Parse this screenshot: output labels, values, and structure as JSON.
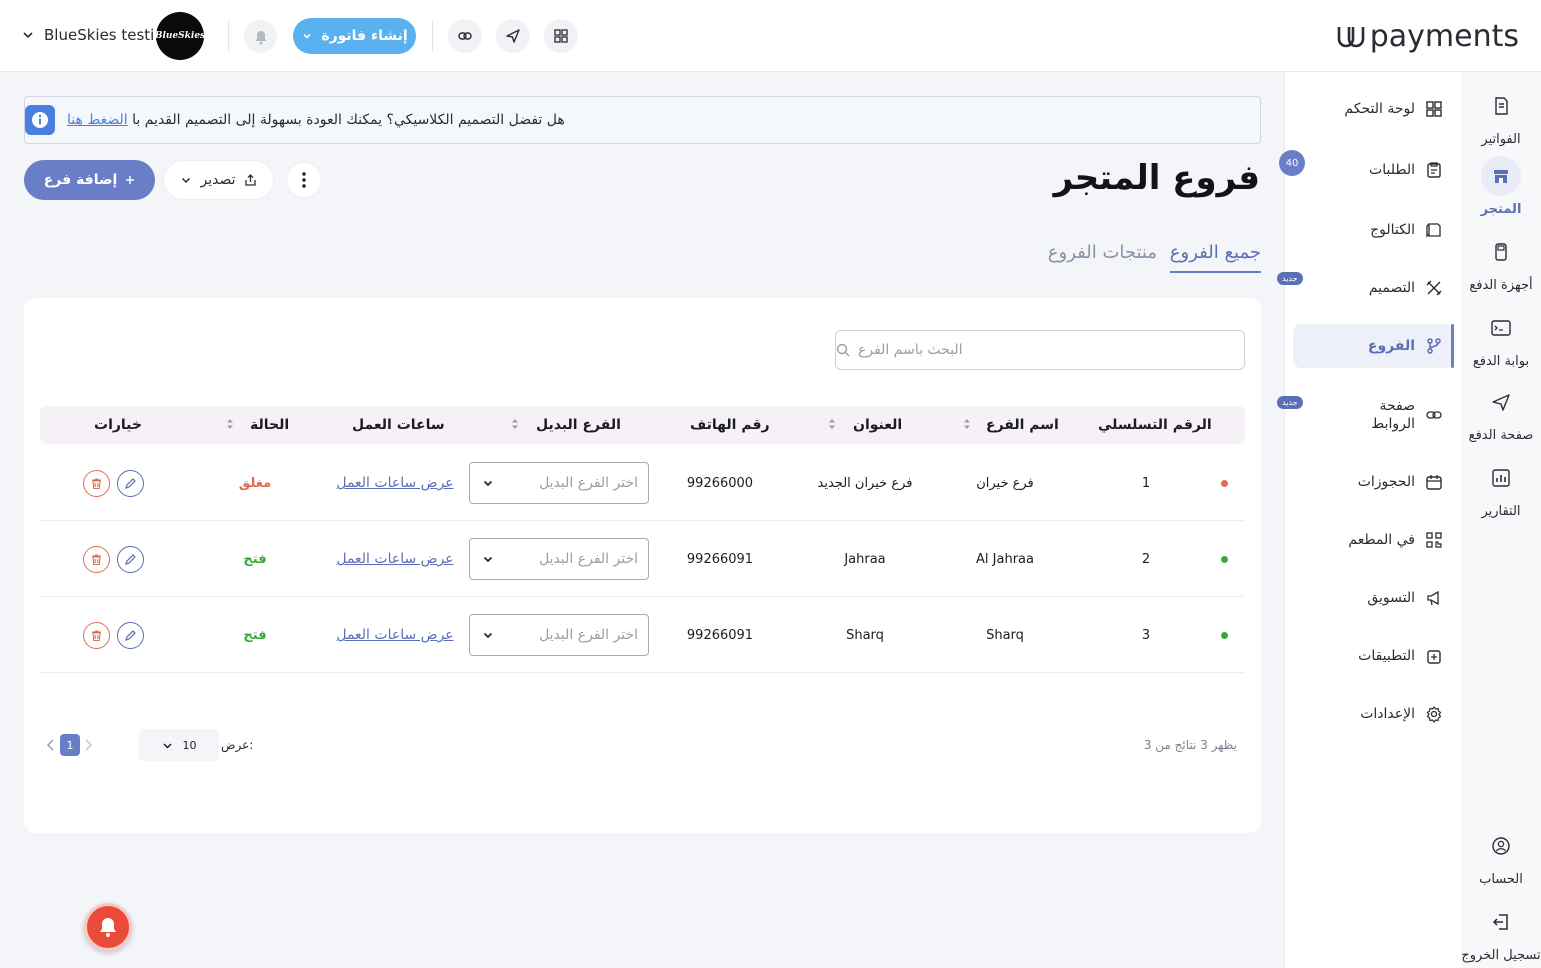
{
  "header": {
    "logo_text": "payments",
    "user_name": "BlueSkies testi...",
    "avatar_text": "BlueSkies",
    "create_invoice_label": "إنشاء فاتورة"
  },
  "notice": {
    "text": "هل تفضل التصميم الكلاسيكي؟ يمكنك العودة بسهولة إلى التصميم القديم با",
    "link": "الضغط هنا"
  },
  "page": {
    "title": "فروع المتجر",
    "add_branch_label": "إضافة فرع",
    "export_label": "تصدير",
    "tabs": [
      {
        "label": "جميع الفروع",
        "active": true
      },
      {
        "label": "منتجات الفروع",
        "active": false
      }
    ],
    "search_placeholder": "البحث باسم الفرع"
  },
  "table": {
    "columns": [
      "الرقم التسلسلي",
      "اسم الفرع",
      "العنوان",
      "رقم الهاتف",
      "الفرع البديل",
      "ساعات العمل",
      "الحالة",
      "خيارات"
    ],
    "select_placeholder": "اختر الفرع البديل",
    "rows": [
      {
        "serial": "1",
        "name": "فرع خيران",
        "address": "فرع خيران الجديد",
        "phone": "99266000",
        "hours": "عرض ساعات العمل",
        "status": "مغلق",
        "dot_color": "#e36b4e"
      },
      {
        "serial": "2",
        "name": "Al Jahraa",
        "address": "Jahraa",
        "phone": "99266091",
        "hours": "عرض ساعات العمل",
        "status": "فتح",
        "dot_color": "#3aaa35"
      },
      {
        "serial": "3",
        "name": "Sharq",
        "address": "Sharq",
        "phone": "99266091",
        "hours": "عرض ساعات العمل",
        "status": "فتح",
        "dot_color": "#3aaa35"
      }
    ]
  },
  "pagination": {
    "summary": "يظهر 3 نتائج من 3",
    "per_page_label": "عرض:",
    "per_page_value": "10",
    "current_page": "1"
  },
  "rail": {
    "items": [
      {
        "label": "الفواتير",
        "icon": "invoice-icon"
      },
      {
        "label": "المتجر",
        "icon": "store-icon",
        "active": true
      },
      {
        "label": "أجهزة الدفع",
        "icon": "pos-device-icon"
      },
      {
        "label": "بوابة الدفع",
        "icon": "gateway-icon"
      },
      {
        "label": "صفحة الدفع",
        "icon": "send-icon"
      },
      {
        "label": "التقارير",
        "icon": "reports-icon"
      }
    ],
    "account_label": "الحساب",
    "logout_label": "تسجيل الخروج"
  },
  "menu": {
    "items": [
      {
        "label": "لوحة التحكم",
        "icon": "dashboard-icon"
      },
      {
        "label": "الطلبات",
        "icon": "orders-icon",
        "count": "40"
      },
      {
        "label": "الكتالوج",
        "icon": "catalog-icon"
      },
      {
        "label": "التصميم",
        "icon": "design-icon",
        "badge": "جديد"
      },
      {
        "label": "الفروع",
        "icon": "branches-icon",
        "active": true
      },
      {
        "label": "صفحة الروابط",
        "icon": "links-icon",
        "badge": "جديد"
      },
      {
        "label": "الحجوزات",
        "icon": "calendar-icon"
      },
      {
        "label": "في المطعم",
        "icon": "qr-icon"
      },
      {
        "label": "التسويق",
        "icon": "megaphone-icon"
      },
      {
        "label": "التطبيقات",
        "icon": "apps-icon"
      },
      {
        "label": "الإعدادات",
        "icon": "settings-icon"
      }
    ]
  },
  "colors": {
    "accent": "#6a7ec7",
    "invoice_button": "#59b1f0",
    "closed": "#e36b4e",
    "open": "#3aaa35"
  }
}
